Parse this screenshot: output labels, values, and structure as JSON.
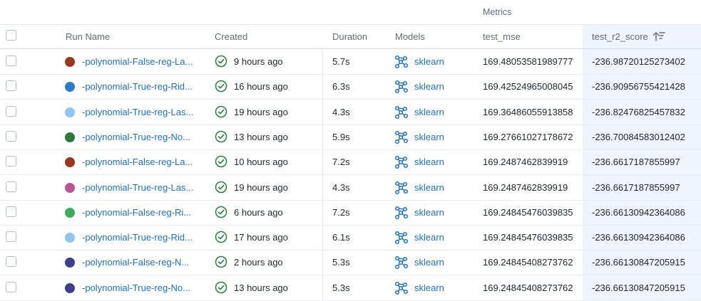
{
  "header": {
    "group_label": "Metrics",
    "columns": {
      "run_name": "Run Name",
      "created": "Created",
      "duration": "Duration",
      "models": "Models",
      "test_mse": "test_mse",
      "test_r2_score": "test_r2_score"
    },
    "sort_icon": "sort-descending-icon"
  },
  "colors": {
    "link": "#2272b4",
    "success": "#277c43",
    "sorted_column_bg": "#eef5fc"
  },
  "rows": [
    {
      "color": "#99361f",
      "run_name": "-polynomial-False-reg-La...",
      "created": "9 hours ago",
      "duration": "5.7s",
      "model": "sklearn",
      "test_mse": "169.48053581989777",
      "test_r2_score": "-236.98720125273402"
    },
    {
      "color": "#2e7bc7",
      "run_name": "-polynomial-True-reg-Rid...",
      "created": "16 hours ago",
      "duration": "6.3s",
      "model": "sklearn",
      "test_mse": "169.42524965008045",
      "test_r2_score": "-236.90956755421428"
    },
    {
      "color": "#8fc6f0",
      "run_name": "-polynomial-True-reg-Las...",
      "created": "19 hours ago",
      "duration": "4.3s",
      "model": "sklearn",
      "test_mse": "169.36486055913858",
      "test_r2_score": "-236.82476825457832"
    },
    {
      "color": "#2d7a3f",
      "run_name": "-polynomial-True-reg-No...",
      "created": "13 hours ago",
      "duration": "5.9s",
      "model": "sklearn",
      "test_mse": "169.27661027178672",
      "test_r2_score": "-236.70084583012402"
    },
    {
      "color": "#99361f",
      "run_name": "-polynomial-False-reg-La...",
      "created": "10 hours ago",
      "duration": "7.2s",
      "model": "sklearn",
      "test_mse": "169.2487462839919",
      "test_r2_score": "-236.6617187855997"
    },
    {
      "color": "#b8558e",
      "run_name": "-polynomial-True-reg-Las...",
      "created": "19 hours ago",
      "duration": "4.3s",
      "model": "sklearn",
      "test_mse": "169.2487462839919",
      "test_r2_score": "-236.6617187855997"
    },
    {
      "color": "#3faa5c",
      "run_name": "-polynomial-False-reg-Ri...",
      "created": "6 hours ago",
      "duration": "7.2s",
      "model": "sklearn",
      "test_mse": "169.24845476039835",
      "test_r2_score": "-236.66130942364086"
    },
    {
      "color": "#8fc6f0",
      "run_name": "-polynomial-True-reg-Rid...",
      "created": "17 hours ago",
      "duration": "6.1s",
      "model": "sklearn",
      "test_mse": "169.24845476039835",
      "test_r2_score": "-236.66130942364086"
    },
    {
      "color": "#3f3f8f",
      "run_name": "-polynomial-False-reg-N...",
      "created": "2 hours ago",
      "duration": "5.3s",
      "model": "sklearn",
      "test_mse": "169.24845408273762",
      "test_r2_score": "-236.66130847205915"
    },
    {
      "color": "#3f3f8f",
      "run_name": "-polynomial-True-reg-No...",
      "created": "13 hours ago",
      "duration": "5.3s",
      "model": "sklearn",
      "test_mse": "169.24845408273762",
      "test_r2_score": "-236.66130847205915"
    }
  ]
}
